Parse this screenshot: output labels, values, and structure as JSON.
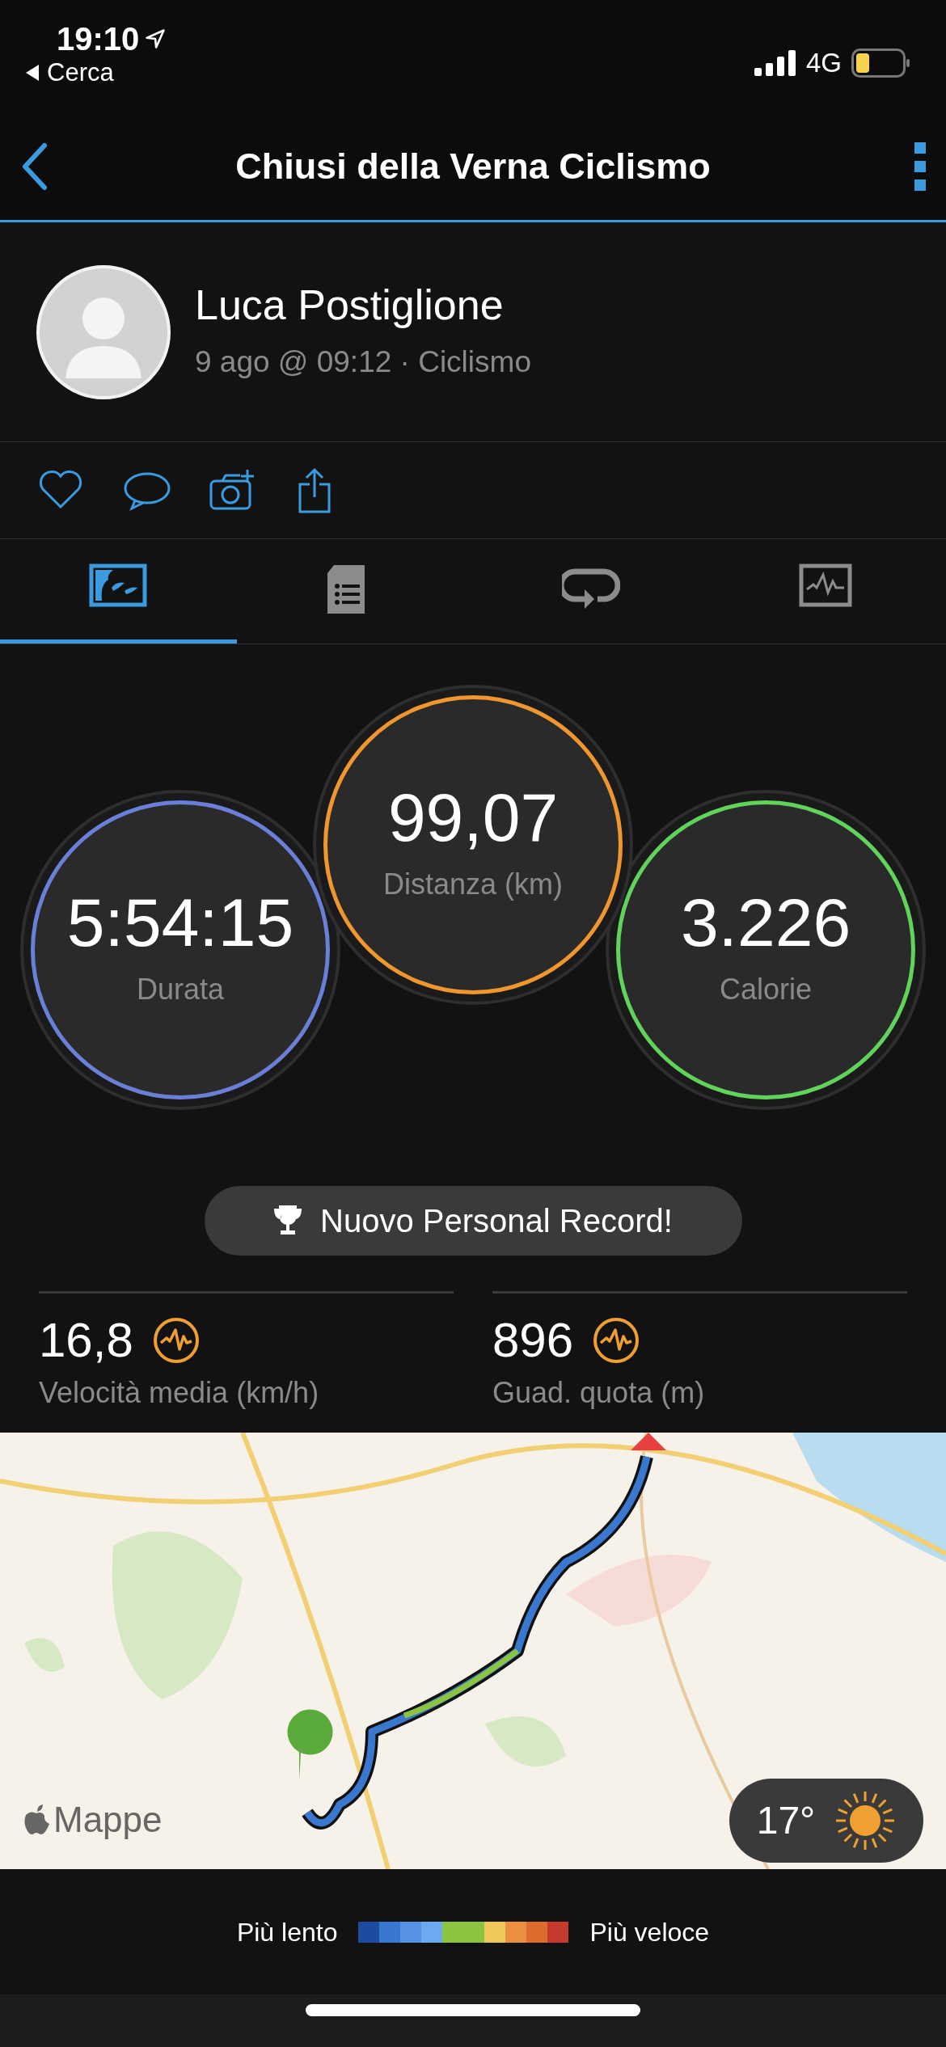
{
  "status_bar": {
    "time": "19:10",
    "back_app": "Cerca",
    "network": "4G"
  },
  "header": {
    "title": "Chiusi della Verna Ciclismo"
  },
  "profile": {
    "name": "Luca Postiglione",
    "subtitle": "9 ago @ 09:12 · Ciclismo"
  },
  "tabs": [
    {
      "kind": "overview",
      "selected": true
    },
    {
      "kind": "details",
      "selected": false
    },
    {
      "kind": "laps",
      "selected": false
    },
    {
      "kind": "charts",
      "selected": false
    }
  ],
  "metrics": [
    {
      "value": "5:54:15",
      "label": "Durata",
      "color": "#6a7fd8"
    },
    {
      "value": "99,07",
      "label": "Distanza (km)",
      "color": "#f0962e"
    },
    {
      "value": "3.226",
      "label": "Calorie",
      "color": "#5fd35a"
    }
  ],
  "record_badge": "Nuovo Personal Record!",
  "stats": [
    {
      "value": "16,8",
      "label": "Velocità media (km/h)"
    },
    {
      "value": "896",
      "label": "Guad. quota (m)"
    }
  ],
  "map": {
    "kind": "picture",
    "attribution": "Mappe",
    "weather": "17°"
  },
  "legend": {
    "slow": "Più lento",
    "fast": "Più veloce",
    "swatches": [
      {
        "color": "#1e4a9f"
      },
      {
        "color": "#3976d1"
      },
      {
        "color": "#5592e6"
      },
      {
        "color": "#6ca9f3"
      },
      {
        "color": "#8cc43f"
      },
      {
        "color": "#8cc43f"
      },
      {
        "color": "#efc85c"
      },
      {
        "color": "#ea8f3f"
      },
      {
        "color": "#dc6c2c"
      },
      {
        "color": "#c6392d"
      }
    ]
  }
}
